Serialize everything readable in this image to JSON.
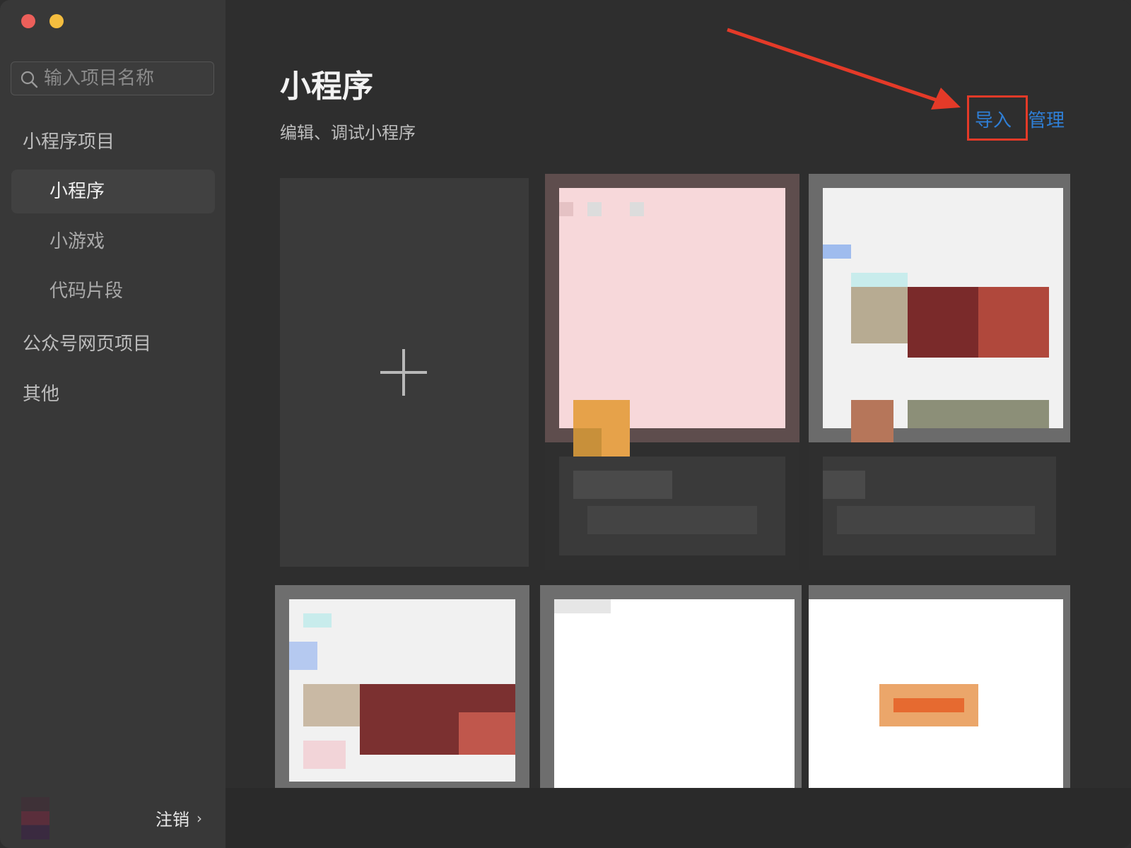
{
  "window": {
    "traffic_lights": [
      "close",
      "minimize"
    ]
  },
  "sidebar": {
    "search": {
      "placeholder": "输入项目名称"
    },
    "groups": [
      {
        "label": "小程序项目"
      },
      {
        "label": "公众号网页项目"
      },
      {
        "label": "其他"
      }
    ],
    "items": [
      {
        "label": "小程序",
        "active": true
      },
      {
        "label": "小游戏",
        "active": false
      },
      {
        "label": "代码片段",
        "active": false
      }
    ],
    "logout_label": "注销",
    "logout_chevron": "›"
  },
  "main": {
    "title": "小程序",
    "subtitle": "编辑、调试小程序",
    "actions": {
      "import_label": "导入",
      "manage_label": "管理"
    },
    "new_project_icon": "plus-icon"
  },
  "colors": {
    "accent_link": "#2f7fd6",
    "annotation_red": "#e43a28",
    "sidebar_bg": "#383838",
    "main_bg": "#2e2e2e"
  }
}
